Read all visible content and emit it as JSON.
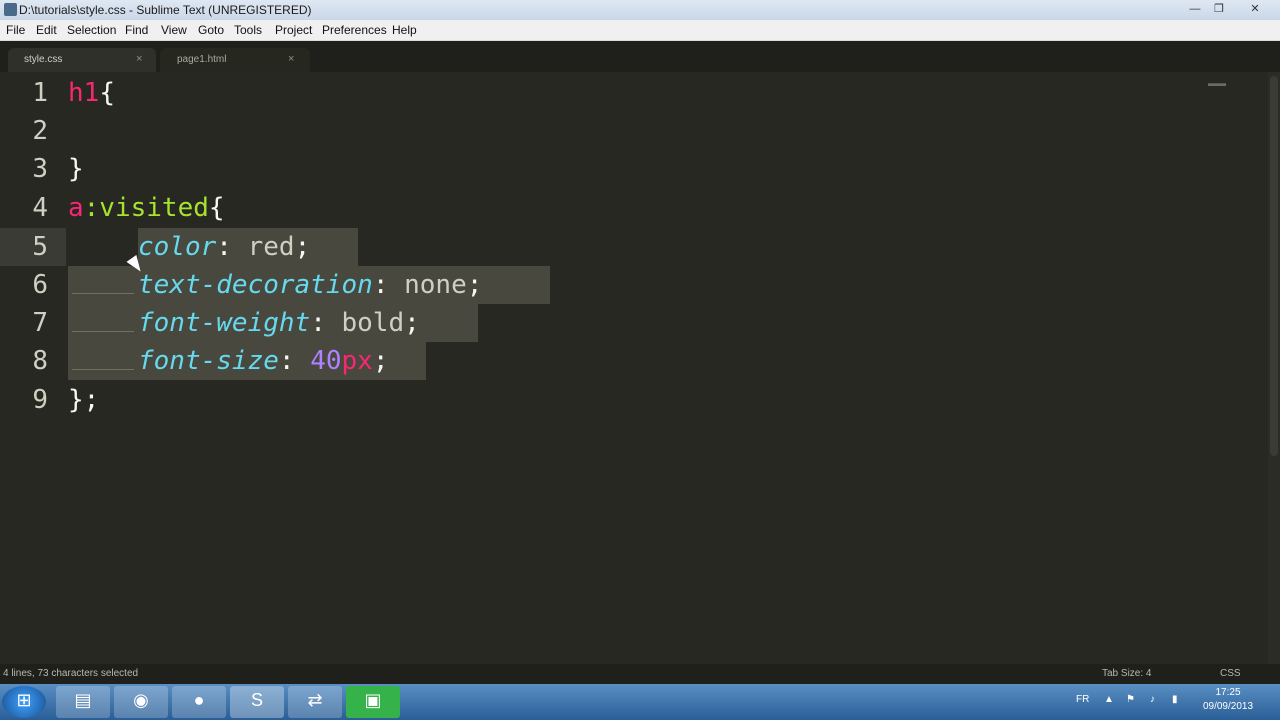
{
  "window": {
    "title": "D:\\tutorials\\style.css - Sublime Text (UNREGISTERED)",
    "minimize": "—",
    "maximize": "❐",
    "close": "✕"
  },
  "menu": [
    "File",
    "Edit",
    "Selection",
    "Find",
    "View",
    "Goto",
    "Tools",
    "Project",
    "Preferences",
    "Help"
  ],
  "tabs": [
    {
      "label": "style.css",
      "active": true,
      "close": "×"
    },
    {
      "label": "page1.html",
      "active": false,
      "close": "×"
    }
  ],
  "editor": {
    "line_numbers": [
      "1",
      "2",
      "3",
      "4",
      "5",
      "6",
      "7",
      "8",
      "9"
    ],
    "lines": {
      "l1": {
        "sel": "h1",
        "brace": "{"
      },
      "l3": {
        "brace": "}"
      },
      "l4": {
        "tag": "a",
        "pseudo": ":visited",
        "brace": "{"
      },
      "l5": {
        "prop": "color",
        "colon": ": ",
        "val": "red",
        "semi": ";"
      },
      "l6": {
        "prop": "text-decoration",
        "colon": ": ",
        "val": "none",
        "semi": ";"
      },
      "l7": {
        "prop": "font-weight",
        "colon": ": ",
        "val": "bold",
        "semi": ";"
      },
      "l8": {
        "prop": "font-size",
        "colon": ": ",
        "num": "40",
        "unit": "px",
        "semi": ";"
      },
      "l9": {
        "text": "};"
      }
    }
  },
  "status": {
    "selection": "4 lines, 73 characters selected",
    "tab_size": "Tab Size: 4",
    "syntax": "CSS"
  },
  "taskbar": {
    "lang": "FR",
    "time": "17:25",
    "date": "09/09/2013",
    "icons": [
      "start-orb-icon",
      "file-explorer-icon",
      "chrome-icon",
      "firefox-icon",
      "sublime-text-icon",
      "network-app-icon",
      "camtasia-icon"
    ]
  },
  "colors": {
    "editor_bg": "#272822",
    "tag": "#f92672",
    "pseudo": "#a6e22e",
    "property": "#66d9ef",
    "number": "#ae81ff",
    "selection": "#49483e"
  }
}
